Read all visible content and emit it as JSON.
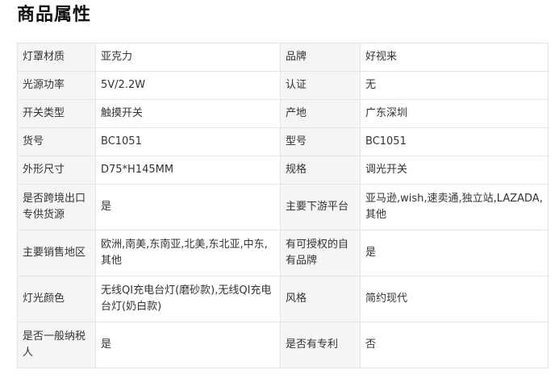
{
  "title": "商品属性",
  "rows": [
    [
      {
        "label": "灯罩材质",
        "value": "亚克力"
      },
      {
        "label": "品牌",
        "value": "好视来"
      }
    ],
    [
      {
        "label": "光源功率",
        "value": "5V/2.2W"
      },
      {
        "label": "认证",
        "value": "无"
      }
    ],
    [
      {
        "label": "开关类型",
        "value": "触摸开关"
      },
      {
        "label": "产地",
        "value": "广东深圳"
      }
    ],
    [
      {
        "label": "货号",
        "value": "BC1051"
      },
      {
        "label": "型号",
        "value": "BC1051"
      }
    ],
    [
      {
        "label": "外形尺寸",
        "value": "D75*H145MM"
      },
      {
        "label": "规格",
        "value": "调光开关"
      }
    ],
    [
      {
        "label": "是否跨境出口专供货源",
        "value": "是"
      },
      {
        "label": "主要下游平台",
        "value": "亚马逊,wish,速卖通,独立站,LAZADA,其他"
      }
    ],
    [
      {
        "label": "主要销售地区",
        "value": "欧洲,南美,东南亚,北美,东北亚,中东,其他"
      },
      {
        "label": "有可授权的自有品牌",
        "value": "是"
      }
    ],
    [
      {
        "label": "灯光颜色",
        "value": "无线QI充电台灯(磨砂款),无线QI充电台灯(奶白款)"
      },
      {
        "label": "风格",
        "value": "简约现代"
      }
    ],
    [
      {
        "label": "是否一般纳税人",
        "value": "是"
      },
      {
        "label": "是否有专利",
        "value": "否"
      }
    ]
  ]
}
